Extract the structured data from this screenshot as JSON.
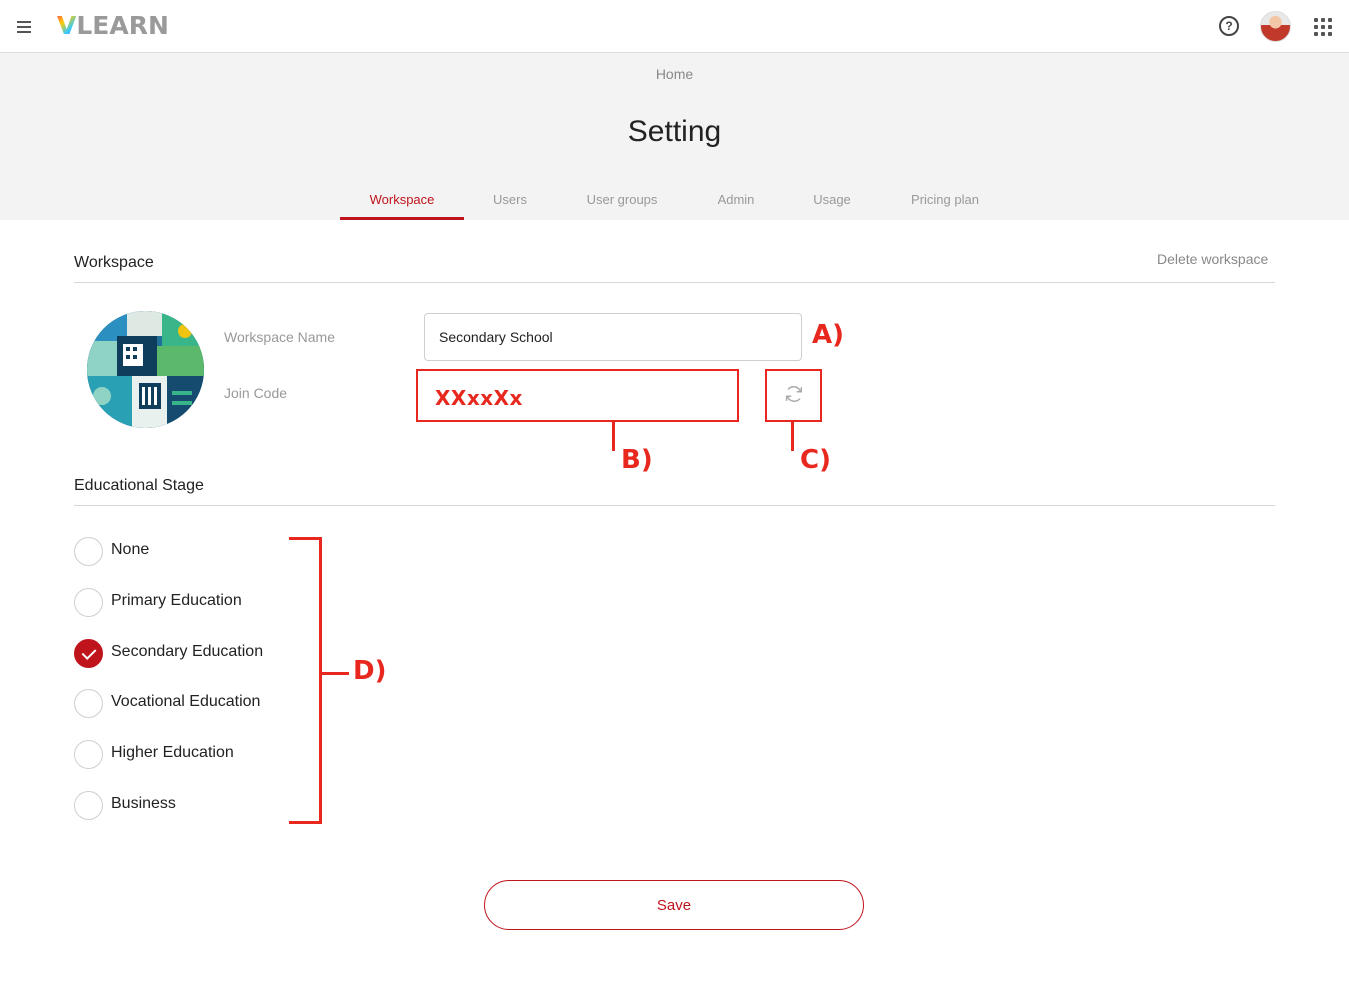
{
  "app": {
    "logo_v": "V",
    "logo_rest": "LEARN",
    "help_symbol": "?",
    "icons": {
      "menu": "hamburger-menu-icon",
      "help": "help-circle-icon",
      "apps": "apps-grid-icon",
      "refresh": "refresh-icon"
    }
  },
  "header": {
    "breadcrumb": "Home",
    "title": "Setting"
  },
  "tabs": [
    {
      "label": "Workspace",
      "active": true
    },
    {
      "label": "Users",
      "active": false
    },
    {
      "label": "User groups",
      "active": false
    },
    {
      "label": "Admin",
      "active": false
    },
    {
      "label": "Usage",
      "active": false
    },
    {
      "label": "Pricing plan",
      "active": false
    }
  ],
  "workspace": {
    "section_title": "Workspace",
    "delete_label": "Delete workspace",
    "name_label": "Workspace Name",
    "name_value": "Secondary School",
    "join_label": "Join Code",
    "join_code": "XXxxXx"
  },
  "educational_stage": {
    "section_title": "Educational Stage",
    "options": [
      {
        "label": "None",
        "checked": false
      },
      {
        "label": "Primary Education",
        "checked": false
      },
      {
        "label": "Secondary Education",
        "checked": true
      },
      {
        "label": "Vocational Education",
        "checked": false
      },
      {
        "label": "Higher Education",
        "checked": false
      },
      {
        "label": "Business",
        "checked": false
      }
    ]
  },
  "annotations": {
    "a": "A)",
    "b": "B)",
    "c": "C)",
    "d": "D)"
  },
  "actions": {
    "save_label": "Save"
  },
  "colors": {
    "accent": "#c0141c",
    "annotation": "#e8281e",
    "header_bg": "#f3f3f3"
  }
}
